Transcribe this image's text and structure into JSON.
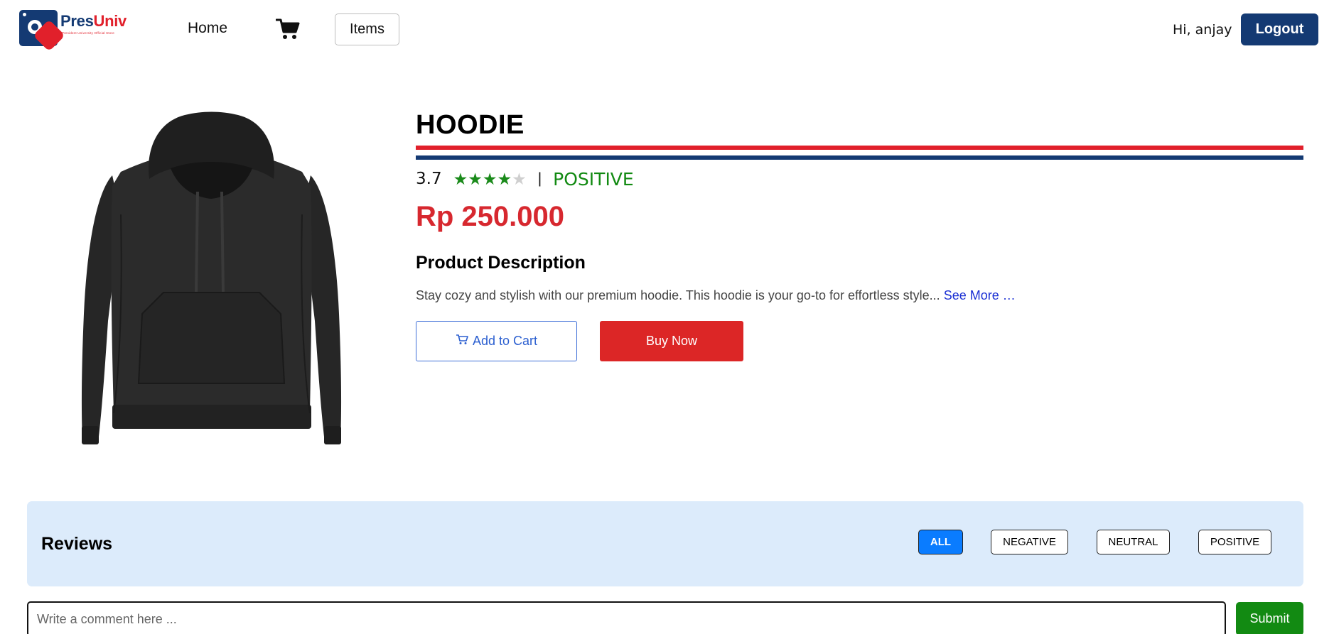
{
  "brand": {
    "name_part1": "Pres",
    "name_part2": "Univ",
    "tagline": "President University Official Store"
  },
  "nav": {
    "home_label": "Home",
    "cart_icon": "cart-icon",
    "items_label": "Items",
    "greeting": "Hi, anjay",
    "logout_label": "Logout"
  },
  "product": {
    "title": "HOODIE",
    "rating": "3.7",
    "rating_value": 3.7,
    "rating_max": 5,
    "separator": "|",
    "sentiment": "POSITIVE",
    "price": "Rp 250.000",
    "description_title": "Product Description",
    "description": "Stay cozy and stylish with our premium hoodie. This hoodie is your go-to for effortless style...",
    "see_more": "See More …",
    "add_to_cart_label": "Add to Cart",
    "buy_now_label": "Buy Now"
  },
  "reviews": {
    "title": "Reviews",
    "filters": [
      "ALL",
      "NEGATIVE",
      "NEUTRAL",
      "POSITIVE"
    ],
    "active_filter": "ALL",
    "comment_placeholder": "Write a comment here ...",
    "submit_label": "Submit"
  },
  "colors": {
    "brand_blue": "#143a73",
    "brand_red": "#e1202b",
    "price_red": "#d7282f",
    "positive_green": "#128a12",
    "active_filter_blue": "#0a7cff",
    "reviews_bg": "#dcebfb"
  }
}
